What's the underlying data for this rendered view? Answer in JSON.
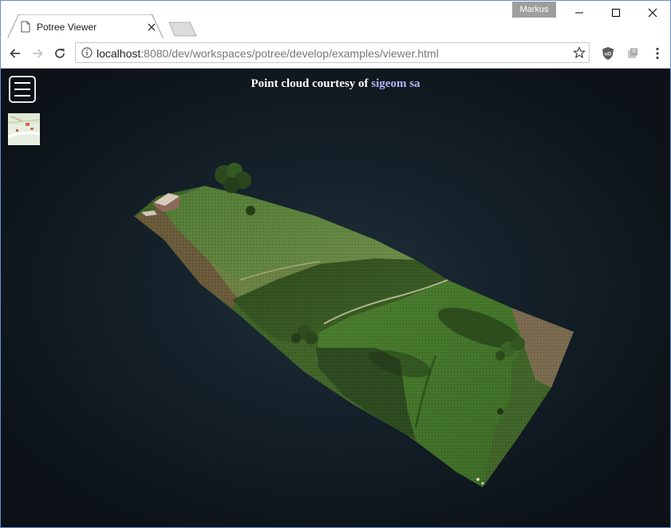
{
  "window": {
    "profile_name": "Markus",
    "controls": [
      "minimize",
      "maximize",
      "close"
    ]
  },
  "tab": {
    "title": "Potree Viewer",
    "icon": "page-icon",
    "close_icon": "close-icon"
  },
  "toolbar": {
    "back_icon": "arrow-left-icon",
    "forward_icon": "arrow-right-icon",
    "reload_icon": "reload-icon",
    "url_host": "localhost",
    "url_rest": ":8080/dev/workspaces/potree/develop/examples/viewer.html",
    "bookmark_icon": "star-icon",
    "extensions": [
      "ublock-origin-icon",
      "extension-icon"
    ],
    "menu_icon": "vertical-dots-icon"
  },
  "viewer": {
    "credit_prefix": "Point cloud courtesy of",
    "credit_link": "sigeom sa",
    "credit_link_color": "#b4b4ff",
    "menu_button_icon": "hamburger-icon",
    "minimap_icon": "map-thumbnail",
    "background_color": "#15212a",
    "content": "3D point cloud of a sloped farmland terrain with fields, trees and a farmhouse"
  }
}
